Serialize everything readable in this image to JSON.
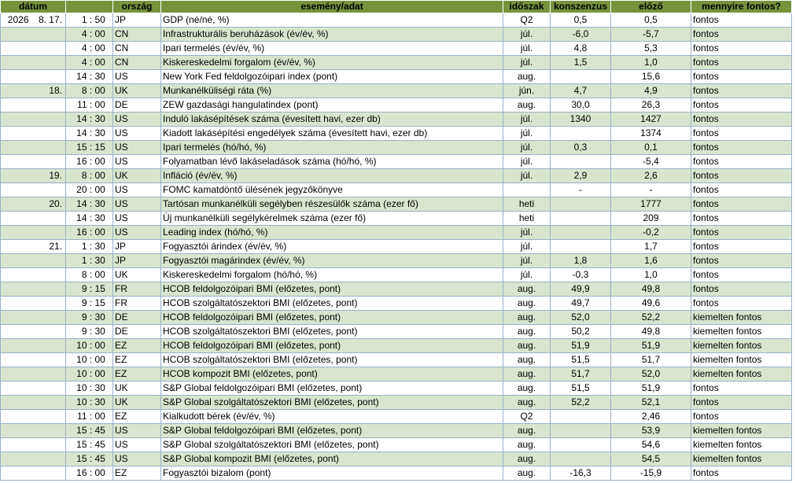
{
  "headers": {
    "datum": "dátum",
    "orszag": "ország",
    "esemeny": "esemény/adat",
    "idoszak": "időszak",
    "konszenzus": "konszenzus",
    "elozo": "előző",
    "fontos": "mennyire fontos?"
  },
  "rows": [
    {
      "year": "2026",
      "md": "8. 17.",
      "h": "1",
      "m": "50",
      "country": "JP",
      "event": "GDP (né/né, %)",
      "period": "Q2",
      "consensus": "0,5",
      "prev": "0,5",
      "imp": "fontos"
    },
    {
      "year": "",
      "md": "",
      "h": "4",
      "m": "00",
      "country": "CN",
      "event": "Infrastrukturális beruházások (év/év, %)",
      "period": "júl.",
      "consensus": "-6,0",
      "prev": "-5,7",
      "imp": "fontos"
    },
    {
      "year": "",
      "md": "",
      "h": "4",
      "m": "00",
      "country": "CN",
      "event": "Ipari termelés (év/év, %)",
      "period": "júl.",
      "consensus": "4,8",
      "prev": "5,3",
      "imp": "fontos"
    },
    {
      "year": "",
      "md": "",
      "h": "4",
      "m": "00",
      "country": "CN",
      "event": "Kiskereskedelmi forgalom (év/év, %)",
      "period": "júl.",
      "consensus": "1,5",
      "prev": "1,0",
      "imp": "fontos"
    },
    {
      "year": "",
      "md": "",
      "h": "14",
      "m": "30",
      "country": "US",
      "event": "New York Fed feldolgozóipari index (pont)",
      "period": "aug.",
      "consensus": "",
      "prev": "15,6",
      "imp": "fontos"
    },
    {
      "year": "",
      "md": "18.",
      "h": "8",
      "m": "00",
      "country": "UK",
      "event": "Munkanélküliségi ráta (%)",
      "period": "jún.",
      "consensus": "4,7",
      "prev": "4,9",
      "imp": "fontos"
    },
    {
      "year": "",
      "md": "",
      "h": "11",
      "m": "00",
      "country": "DE",
      "event": "ZEW gazdasági hangulatindex (pont)",
      "period": "aug.",
      "consensus": "30,0",
      "prev": "26,3",
      "imp": "fontos"
    },
    {
      "year": "",
      "md": "",
      "h": "14",
      "m": "30",
      "country": "US",
      "event": "Induló lakásépítések száma (évesített havi, ezer db)",
      "period": "júl.",
      "consensus": "1340",
      "prev": "1427",
      "imp": "fontos"
    },
    {
      "year": "",
      "md": "",
      "h": "14",
      "m": "30",
      "country": "US",
      "event": "Kiadott lakásépítési engedélyek száma (évesített havi, ezer db)",
      "period": "júl.",
      "consensus": "",
      "prev": "1374",
      "imp": "fontos"
    },
    {
      "year": "",
      "md": "",
      "h": "15",
      "m": "15",
      "country": "US",
      "event": "Ipari termelés (hó/hó, %)",
      "period": "júl.",
      "consensus": "0,3",
      "prev": "0,1",
      "imp": "fontos"
    },
    {
      "year": "",
      "md": "",
      "h": "16",
      "m": "00",
      "country": "US",
      "event": "Folyamatban lévő lakáseladások száma (hó/hó, %)",
      "period": "júl.",
      "consensus": "",
      "prev": "-5,4",
      "imp": "fontos"
    },
    {
      "year": "",
      "md": "19.",
      "h": "8",
      "m": "00",
      "country": "UK",
      "event": "Infláció (év/év, %)",
      "period": "júl.",
      "consensus": "2,9",
      "prev": "2,6",
      "imp": "fontos"
    },
    {
      "year": "",
      "md": "",
      "h": "20",
      "m": "00",
      "country": "US",
      "event": "FOMC kamatdöntő ülésének jegyzőkönyve",
      "period": "",
      "consensus": "-",
      "prev": "-",
      "imp": "fontos"
    },
    {
      "year": "",
      "md": "20.",
      "h": "14",
      "m": "30",
      "country": "US",
      "event": "Tartósan munkanélküli segélyben részesülők száma (ezer fő)",
      "period": "heti",
      "consensus": "",
      "prev": "1777",
      "imp": "fontos"
    },
    {
      "year": "",
      "md": "",
      "h": "14",
      "m": "30",
      "country": "US",
      "event": "Új munkanélküli segélykérelmek száma (ezer fő)",
      "period": "heti",
      "consensus": "",
      "prev": "209",
      "imp": "fontos"
    },
    {
      "year": "",
      "md": "",
      "h": "16",
      "m": "00",
      "country": "US",
      "event": "Leading index (hó/hó, %)",
      "period": "júl.",
      "consensus": "",
      "prev": "-0,2",
      "imp": "fontos"
    },
    {
      "year": "",
      "md": "21.",
      "h": "1",
      "m": "30",
      "country": "JP",
      "event": "Fogyasztói árindex (év/év, %)",
      "period": "júl.",
      "consensus": "",
      "prev": "1,7",
      "imp": "fontos"
    },
    {
      "year": "",
      "md": "",
      "h": "1",
      "m": "30",
      "country": "JP",
      "event": "Fogyasztói magárindex (év/év, %)",
      "period": "júl.",
      "consensus": "1,8",
      "prev": "1,6",
      "imp": "fontos"
    },
    {
      "year": "",
      "md": "",
      "h": "8",
      "m": "00",
      "country": "UK",
      "event": "Kiskereskedelmi forgalom (hó/hó, %)",
      "period": "júl.",
      "consensus": "-0,3",
      "prev": "1,0",
      "imp": "fontos"
    },
    {
      "year": "",
      "md": "",
      "h": "9",
      "m": "15",
      "country": "FR",
      "event": "HCOB feldolgozóipari BMI (előzetes, pont)",
      "period": "aug.",
      "consensus": "49,9",
      "prev": "49,8",
      "imp": "fontos"
    },
    {
      "year": "",
      "md": "",
      "h": "9",
      "m": "15",
      "country": "FR",
      "event": "HCOB szolgáltatószektori BMI (előzetes, pont)",
      "period": "aug.",
      "consensus": "49,7",
      "prev": "49,6",
      "imp": "fontos"
    },
    {
      "year": "",
      "md": "",
      "h": "9",
      "m": "30",
      "country": "DE",
      "event": "HCOB feldolgozóipari BMI (előzetes, pont)",
      "period": "aug.",
      "consensus": "52,0",
      "prev": "52,2",
      "imp": "kiemelten fontos"
    },
    {
      "year": "",
      "md": "",
      "h": "9",
      "m": "30",
      "country": "DE",
      "event": "HCOB szolgáltatószektori BMI (előzetes, pont)",
      "period": "aug.",
      "consensus": "50,2",
      "prev": "49,8",
      "imp": "kiemelten fontos"
    },
    {
      "year": "",
      "md": "",
      "h": "10",
      "m": "00",
      "country": "EZ",
      "event": "HCOB feldolgozóipari BMI (előzetes, pont)",
      "period": "aug.",
      "consensus": "51,9",
      "prev": "51,9",
      "imp": "kiemelten fontos"
    },
    {
      "year": "",
      "md": "",
      "h": "10",
      "m": "00",
      "country": "EZ",
      "event": "HCOB szolgáltatószektori BMI (előzetes, pont)",
      "period": "aug.",
      "consensus": "51,5",
      "prev": "51,7",
      "imp": "kiemelten fontos"
    },
    {
      "year": "",
      "md": "",
      "h": "10",
      "m": "00",
      "country": "EZ",
      "event": "HCOB kompozit BMI (előzetes, pont)",
      "period": "aug.",
      "consensus": "51,7",
      "prev": "52,0",
      "imp": "kiemelten fontos"
    },
    {
      "year": "",
      "md": "",
      "h": "10",
      "m": "30",
      "country": "UK",
      "event": "S&P Global feldolgozóipari BMI (előzetes, pont)",
      "period": "aug.",
      "consensus": "51,5",
      "prev": "51,9",
      "imp": "fontos"
    },
    {
      "year": "",
      "md": "",
      "h": "10",
      "m": "30",
      "country": "UK",
      "event": "S&P Global szolgáltatószektori BMI (előzetes, pont)",
      "period": "aug.",
      "consensus": "52,2",
      "prev": "52,1",
      "imp": "fontos"
    },
    {
      "year": "",
      "md": "",
      "h": "11",
      "m": "00",
      "country": "EZ",
      "event": "Kialkudott bérek (év/év, %)",
      "period": "Q2",
      "consensus": "",
      "prev": "2,46",
      "imp": "fontos"
    },
    {
      "year": "",
      "md": "",
      "h": "15",
      "m": "45",
      "country": "US",
      "event": "S&P Global feldolgozóipari BMI (előzetes, pont)",
      "period": "aug.",
      "consensus": "",
      "prev": "53,9",
      "imp": "kiemelten fontos"
    },
    {
      "year": "",
      "md": "",
      "h": "15",
      "m": "45",
      "country": "US",
      "event": "S&P Global szolgáltatószektori BMI (előzetes, pont)",
      "period": "aug.",
      "consensus": "",
      "prev": "54,6",
      "imp": "kiemelten fontos"
    },
    {
      "year": "",
      "md": "",
      "h": "15",
      "m": "45",
      "country": "US",
      "event": "S&P Global kompozit BMI (előzetes, pont)",
      "period": "aug.",
      "consensus": "",
      "prev": "54,5",
      "imp": "kiemelten fontos"
    },
    {
      "year": "",
      "md": "",
      "h": "16",
      "m": "00",
      "country": "EZ",
      "event": "Fogyasztói bizalom (pont)",
      "period": "aug.",
      "consensus": "-16,3",
      "prev": "-15,9",
      "imp": "fontos"
    }
  ]
}
